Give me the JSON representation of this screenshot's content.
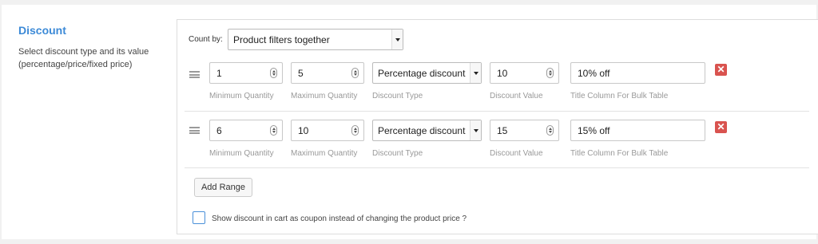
{
  "section": {
    "title": "Discount",
    "description": "Select discount type and its value (percentage/price/fixed price)"
  },
  "count_by": {
    "label": "Count by:",
    "selected": "Product filters together"
  },
  "labels": {
    "min_qty": "Minimum Quantity",
    "max_qty": "Maximum Quantity",
    "discount_type": "Discount Type",
    "discount_value": "Discount Value",
    "title_column": "Title Column For Bulk Table"
  },
  "ranges": [
    {
      "min": "1",
      "max": "5",
      "type": "Percentage discount",
      "value": "10",
      "title": "10% off"
    },
    {
      "min": "6",
      "max": "10",
      "type": "Percentage discount",
      "value": "15",
      "title": "15% off"
    }
  ],
  "add_range_label": "Add Range",
  "coupon_checkbox": {
    "label": "Show discount in cart as coupon instead of changing the product price ?",
    "checked": false
  },
  "colors": {
    "accent": "#3c8ad7",
    "delete": "#d9534f"
  },
  "icons": {
    "drag": "drag-handle-icon",
    "spinner": "number-spinner-icon",
    "delete": "close-icon",
    "dropdown": "chevron-down-icon"
  }
}
